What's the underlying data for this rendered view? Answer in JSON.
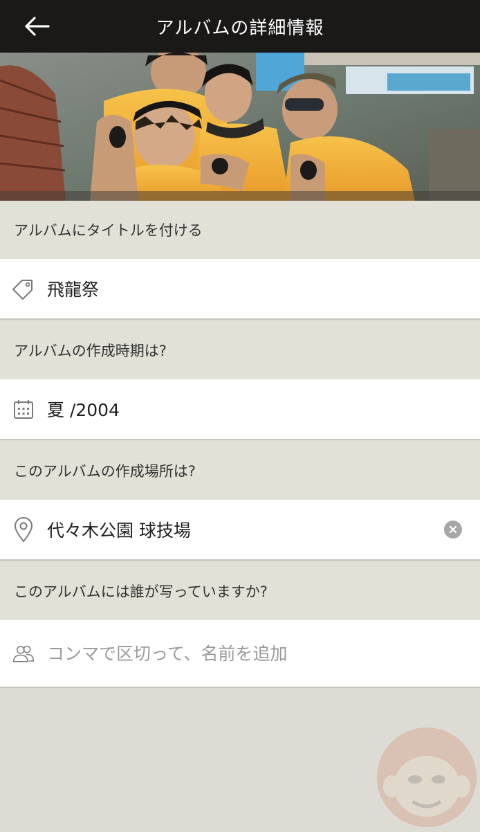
{
  "header": {
    "title": "アルバムの詳細情報",
    "back_icon": "arrow-left-icon"
  },
  "sections": {
    "title": {
      "label": "アルバムにタイトルを付ける",
      "value": "飛龍祭",
      "icon": "tag-icon"
    },
    "date": {
      "label": "アルバムの作成時期は?",
      "value": "夏 /2004",
      "icon": "calendar-icon"
    },
    "location": {
      "label": "このアルバムの作成場所は?",
      "value": "代々木公園 球技場",
      "icon": "location-pin-icon",
      "clear_icon": "clear-icon"
    },
    "people": {
      "label": "このアルバムには誰が写っていますか?",
      "placeholder": "コンマで区切って、名前を追加",
      "icon": "people-icon"
    }
  },
  "colors": {
    "header_bg": "#1a1918",
    "page_bg": "#dddcd4",
    "row_bg": "#ffffff",
    "accent_shirt": "#f0b23a"
  }
}
